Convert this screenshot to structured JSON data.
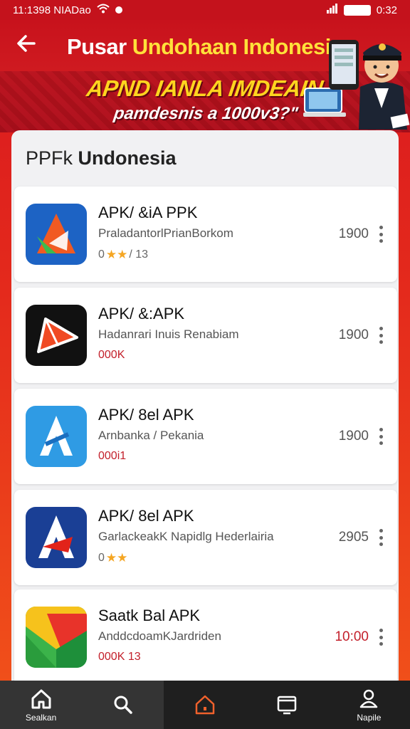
{
  "status_bar": {
    "time_left": "11:1398 NIADao",
    "time_right": "0:32"
  },
  "header": {
    "title_part1": "Pusar ",
    "title_part2": "Undohaan Indonesia",
    "banner_line1": "APND IANLA IMDEAIN",
    "banner_line2": "pamdesnis a 1000v3?\""
  },
  "list": {
    "heading_part1": "PPFk ",
    "heading_part2": "Undonesia",
    "apps": [
      {
        "name": "APK/ &iA PPK",
        "desc": "PraladantorlPrianBorkom",
        "meta": "0",
        "rating_text": "/ 13",
        "size": "1900"
      },
      {
        "name": "APK/ &:APK",
        "desc": "Hadanrari Inuis Renabiam",
        "meta": "000K",
        "size": "1900"
      },
      {
        "name": "APK/ 8el APK",
        "desc": "Arnbanka / Pekania",
        "meta": "000i1",
        "size": "1900"
      },
      {
        "name": "APK/ 8el APK",
        "desc": "GarlackeakK Napidlg Hederlairia",
        "meta": "0",
        "size": "2905"
      },
      {
        "name": "Saatk Bal APK",
        "desc": "AnddcdoamKJardriden",
        "meta": "000K 13",
        "size": "10:00"
      }
    ]
  },
  "bottom_nav": {
    "items": [
      {
        "label": "Sealkan",
        "icon": "home-icon"
      },
      {
        "label": "",
        "icon": "search-icon"
      },
      {
        "label": "",
        "icon": "home-icon"
      },
      {
        "label": "",
        "icon": "window-icon"
      },
      {
        "label": "Napile",
        "icon": "profile-icon"
      }
    ]
  },
  "colors": {
    "brand_red": "#d8171f",
    "accent_yellow": "#ffd51f",
    "orange": "#f2541a"
  }
}
